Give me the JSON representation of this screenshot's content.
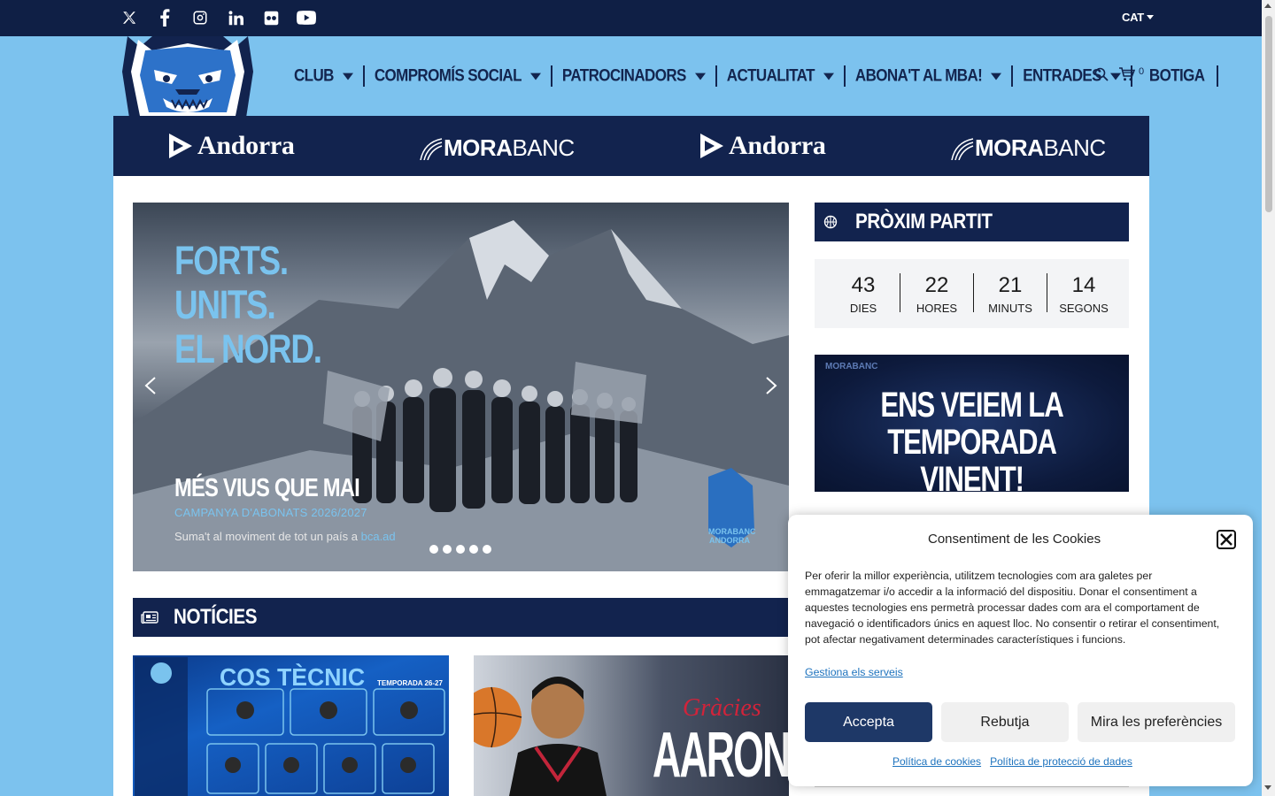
{
  "topbar": {
    "social_icons": [
      "x-twitter-icon",
      "facebook-icon",
      "instagram-icon",
      "linkedin-icon",
      "flickr-icon",
      "youtube-icon"
    ],
    "language": "CAT"
  },
  "nav": {
    "items": [
      {
        "label": "CLUB",
        "has_dropdown": true
      },
      {
        "label": "COMPROMÍS SOCIAL",
        "has_dropdown": true
      },
      {
        "label": "PATROCINADORS",
        "has_dropdown": true
      },
      {
        "label": "ACTUALITAT",
        "has_dropdown": true
      },
      {
        "label": "ABONA'T AL MBA!",
        "has_dropdown": true
      },
      {
        "label": "ENTRADES",
        "has_dropdown": true
      },
      {
        "label": "BOTIGA",
        "has_dropdown": false
      }
    ],
    "cart_count": "0"
  },
  "sponsors": {
    "andorra": "Andorra",
    "mora_bold": "MORA",
    "mora_light": "BANC"
  },
  "slider": {
    "headline_1": "FORTS.",
    "headline_2": "UNITS.",
    "headline_3": "EL NORD.",
    "title": "MÉS VIUS QUE MAI",
    "subtitle": "CAMPANYA D'ABONATS 2026/2027",
    "tagline": "Suma't al moviment de tot un país a",
    "tagline_link": "bca.ad",
    "logo_text_1": "MORABANC",
    "logo_text_2": "ANDORRA",
    "dot_count": 5
  },
  "next_match": {
    "title": "PRÒXIM PARTIT",
    "countdown": [
      {
        "value": "43",
        "label": "DIES"
      },
      {
        "value": "22",
        "label": "HORES"
      },
      {
        "value": "21",
        "label": "MINUTS"
      },
      {
        "value": "14",
        "label": "SEGONS"
      }
    ],
    "promo_line_1": "ENS VEIEM LA",
    "promo_line_2": "TEMPORADA VINENT!",
    "promo_brand": "MORABANC"
  },
  "news": {
    "title": "NOTÍCIES",
    "card1_title": "COS TÈCNIC",
    "card1_sub": "TEMPORADA 26-27",
    "card2_small": "Gràcies",
    "card2_name": "AARON"
  },
  "cookies": {
    "title": "Consentiment de les Cookies",
    "body": "Per oferir la millor experiència, utilitzem tecnologies com ara galetes per emmagatzemar i/o accedir a la informació del dispositiu. Donar el consentiment a aquestes tecnologies ens permetrà processar dades com ara el comportament de navegació o identificadors únics en aquest lloc. No consentir o retirar el consentiment, pot afectar negativament determinades característiques i funcions.",
    "manage": "Gestiona els serveis",
    "accept": "Accepta",
    "reject": "Rebutja",
    "preferences": "Mira les preferències",
    "cookie_policy": "Política de cookies",
    "privacy_policy": "Política de protecció de dades"
  },
  "colors": {
    "navy": "#12234e",
    "sky": "#7cc2ee",
    "accept_button": "#1e3867",
    "link": "#1e73be"
  }
}
